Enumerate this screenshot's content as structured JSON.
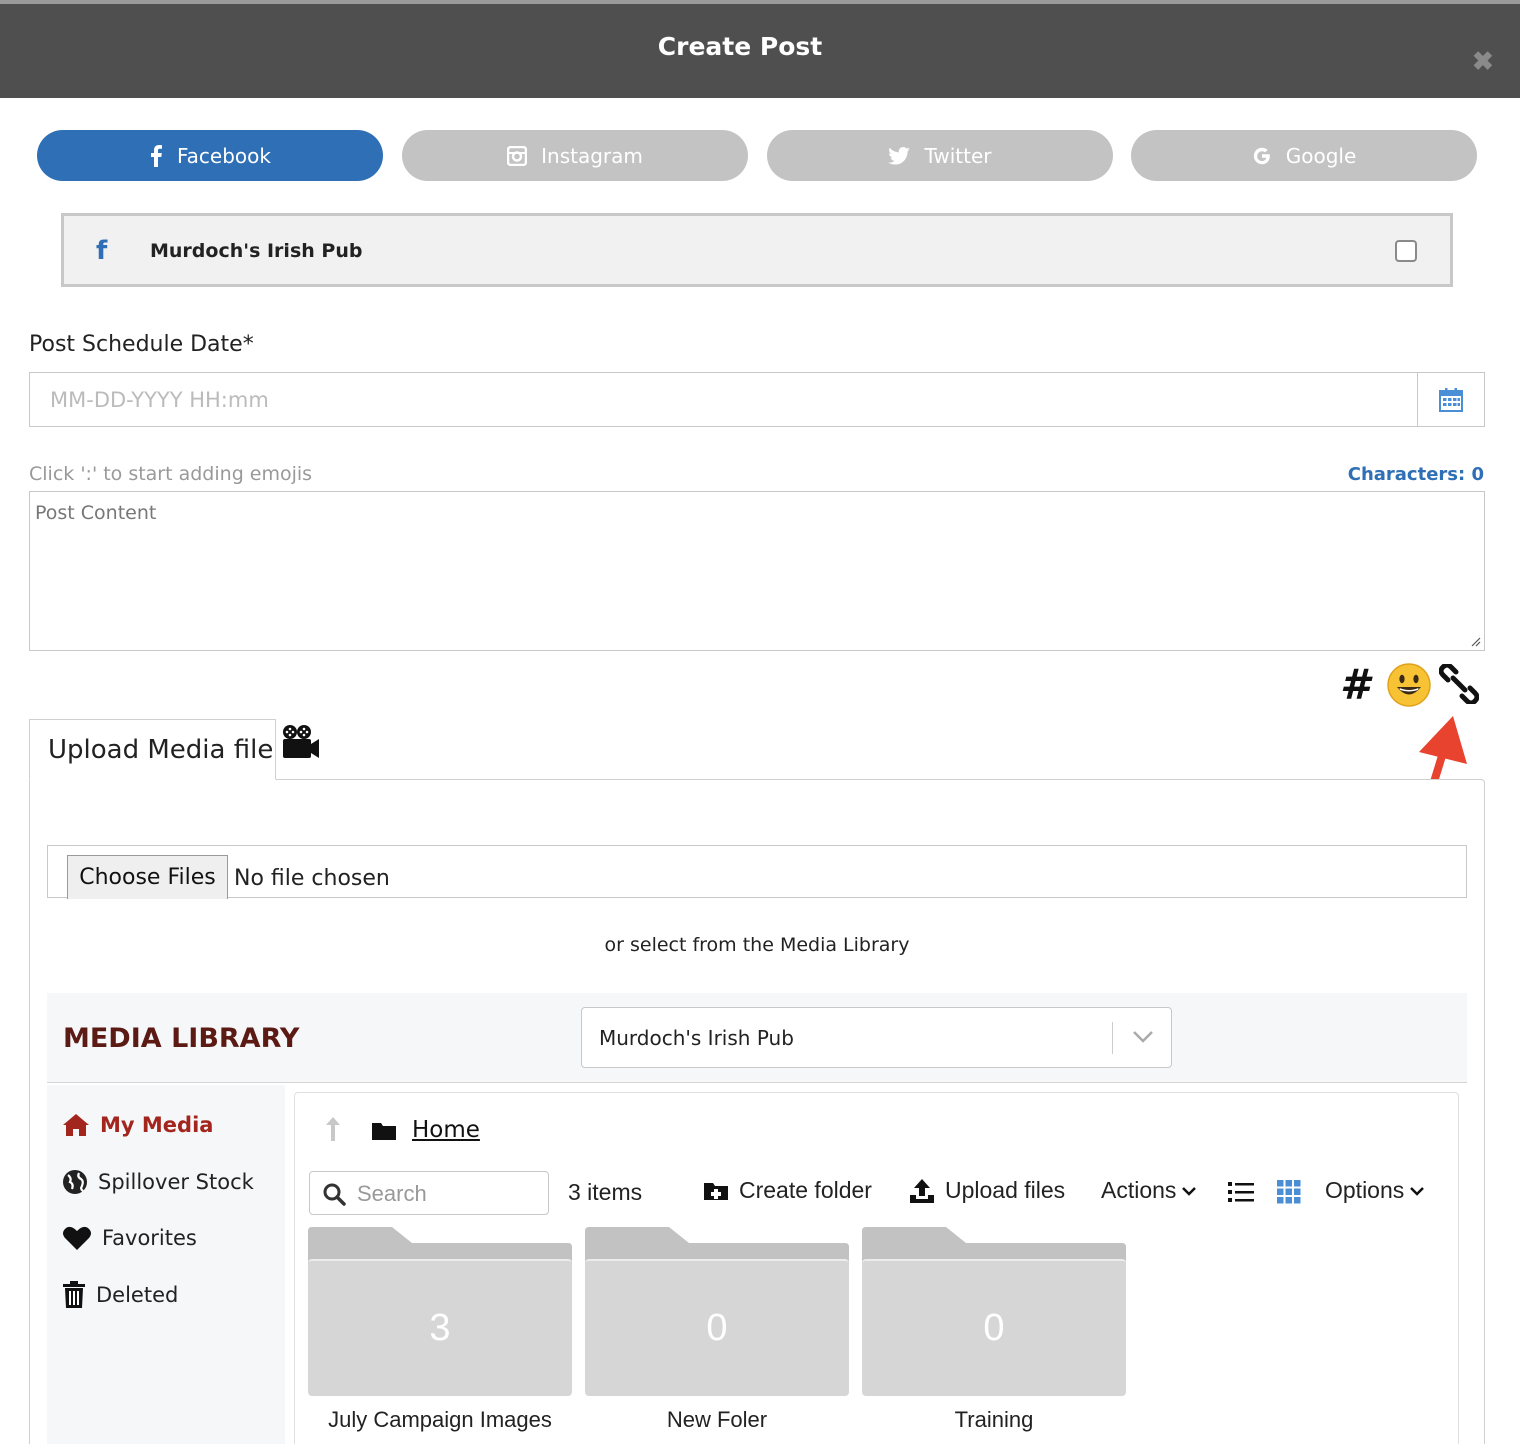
{
  "modal": {
    "title": "Create Post",
    "close": "✖"
  },
  "platforms": [
    {
      "label": "Facebook",
      "active": true
    },
    {
      "label": "Instagram",
      "active": false
    },
    {
      "label": "Twitter",
      "active": false
    },
    {
      "label": "Google",
      "active": false
    }
  ],
  "account": {
    "icon_glyph": "f",
    "name": "Murdoch's Irish Pub",
    "checked": false
  },
  "schedule": {
    "label": "Post Schedule Date*",
    "placeholder": "MM-DD-YYYY HH:mm"
  },
  "content": {
    "emoji_hint": "Click ':' to start adding emojis",
    "characters": "Characters: 0",
    "placeholder": "Post Content"
  },
  "tools": {
    "hashtag": "#"
  },
  "upload": {
    "tab_label": "Upload Media file",
    "choose_files": "Choose Files",
    "no_file": "No file chosen",
    "or_select": "or select from the Media Library"
  },
  "media_library": {
    "title": "MEDIA LIBRARY",
    "selected_account": "Murdoch's Irish Pub",
    "sidebar": [
      {
        "label": "My Media",
        "icon": "home-icon",
        "active": true
      },
      {
        "label": "Spillover Stock",
        "icon": "globe-icon",
        "active": false
      },
      {
        "label": "Favorites",
        "icon": "heart-icon",
        "active": false
      },
      {
        "label": "Deleted",
        "icon": "trash-icon",
        "active": false
      }
    ],
    "breadcrumb": "Home",
    "search_placeholder": "Search",
    "items_count": "3 items",
    "toolbar": {
      "create_folder": "Create folder",
      "upload_files": "Upload files",
      "actions": "Actions",
      "options": "Options"
    },
    "folders": [
      {
        "name": "July Campaign Images",
        "count": "3"
      },
      {
        "name": "New Foler",
        "count": "0"
      },
      {
        "name": "Training",
        "count": "0"
      }
    ]
  },
  "colors": {
    "header": "#4f4f4f",
    "facebook_blue": "#2f6fb6",
    "inactive_tab": "#c3c3c3",
    "library_title": "#5b1a14",
    "active_nav": "#a3261e",
    "annotation": "#e8432e"
  }
}
